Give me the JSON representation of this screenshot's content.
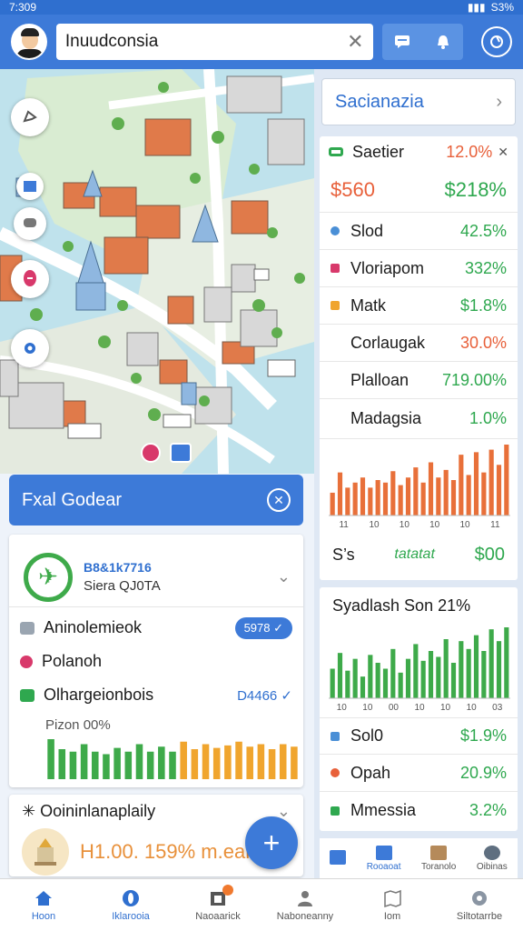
{
  "status_bar": {
    "time": "7:309",
    "battery": "S3%"
  },
  "app_bar": {
    "search_value": "Inuudconsia",
    "clear_icon": "close-icon",
    "icons": [
      "chat-icon",
      "bell-icon",
      "help-icon"
    ]
  },
  "map": {
    "fab_icons": [
      "layers-icon",
      "filter-icon",
      "chat-bubble-icon",
      "pin-icon",
      "location-icon"
    ]
  },
  "event_banner": {
    "label": "Fxal Godear"
  },
  "flight_card": {
    "code": "B8&1k7716",
    "subtitle": "Siera QJ0TA",
    "rows": [
      {
        "label": "Aninolemieok",
        "badge": "5978 ✓",
        "color": "#9aa5b1"
      },
      {
        "label": "Polanoh",
        "badge": "",
        "color": "#d8396b"
      },
      {
        "label": "Olhargeionbois",
        "badge": "D4466 ✓",
        "color": "#2fa84f"
      }
    ],
    "pct_label": "Pizon 00%",
    "chart_data": {
      "type": "bar",
      "values": [
        32,
        24,
        22,
        28,
        22,
        20,
        25,
        22,
        28,
        22,
        26,
        22,
        30,
        24,
        28,
        25,
        27,
        30,
        26,
        28,
        24,
        28,
        26
      ],
      "colors_split": 12
    }
  },
  "ceremony_card": {
    "title": "Ooininlanaplaily",
    "value": "H1.00. 159% m.eam"
  },
  "right_panel": {
    "location": "Sacianazia",
    "header": {
      "label": "Saetier",
      "pct": "12.0%"
    },
    "rows": [
      {
        "label": "$560",
        "value": "$218%",
        "dot": "",
        "big": true
      },
      {
        "label": "Slod",
        "value": "42.5%",
        "dot": "#4a8fd6"
      },
      {
        "label": "Vloriapom",
        "value": "332%",
        "dot": "#d8396b"
      },
      {
        "label": "Matk",
        "value": "$1.8%",
        "dot": "#f0a52e"
      },
      {
        "label": "Corlaugak",
        "value": "30.0%",
        "dot": "",
        "orange": true
      },
      {
        "label": "Plalloan",
        "value": "719.00%",
        "dot": ""
      },
      {
        "label": "Madagsia",
        "value": "1.0%",
        "dot": ""
      }
    ],
    "chart1": {
      "type": "bar",
      "values": [
        18,
        34,
        22,
        26,
        30,
        22,
        28,
        26,
        35,
        24,
        30,
        38,
        26,
        42,
        30,
        36,
        28,
        48,
        32,
        50,
        34,
        52,
        40,
        56
      ],
      "tick_labels": [
        "11",
        "10",
        "10",
        "10",
        "10",
        "11"
      ],
      "foot_left": "S’s",
      "foot_mid": "tatatat",
      "foot_right": "$00"
    },
    "summary_title": "Syadlash  Son 21%",
    "chart2": {
      "type": "bar",
      "values": [
        30,
        46,
        28,
        40,
        22,
        44,
        36,
        30,
        50,
        26,
        40,
        55,
        38,
        48,
        42,
        60,
        36,
        58,
        50,
        64,
        48,
        70,
        58,
        72
      ],
      "tick_labels": [
        "10",
        "10",
        "00",
        "10",
        "10",
        "10",
        "03"
      ]
    },
    "rows2": [
      {
        "label": "Sol0",
        "value": "$1.9%",
        "dot": "#4a8fd6"
      },
      {
        "label": "Opah",
        "value": "20.9%",
        "dot": "#e8603a"
      },
      {
        "label": "Mmessia",
        "value": "3.2%",
        "dot": "#2fa84f"
      }
    ],
    "mini_tabs": [
      {
        "label": "",
        "active": false,
        "color": "#3d7ad8"
      },
      {
        "label": "Rooaoat",
        "active": true,
        "color": "#3d7ad8"
      },
      {
        "label": "Toranolo",
        "active": false,
        "color": "#b58a5a"
      },
      {
        "label": "Oibinas",
        "active": false,
        "color": "#5f6f80"
      }
    ]
  },
  "bottom_nav": [
    {
      "label": "Hoon",
      "icon": "home-icon",
      "active": true
    },
    {
      "label": "Iklarooia",
      "icon": "compass-icon",
      "active": true
    },
    {
      "label": "Naoaarick",
      "icon": "calendar-icon",
      "active": false
    },
    {
      "label": "Naboneanny",
      "icon": "people-icon",
      "active": false
    },
    {
      "label": "Iom",
      "icon": "map-icon",
      "active": false
    },
    {
      "label": "Siltotarrbe",
      "icon": "settings-icon",
      "active": false
    }
  ]
}
